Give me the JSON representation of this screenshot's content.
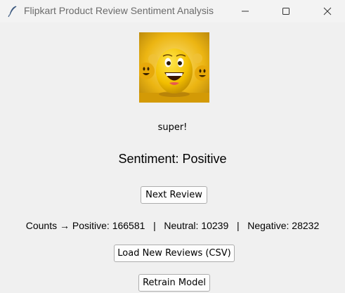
{
  "window": {
    "title": "Flipkart Product Review Sentiment Analysis",
    "icon": "feather-icon"
  },
  "review": {
    "text": "super!"
  },
  "sentiment": {
    "label": "Sentiment: Positive"
  },
  "buttons": {
    "next_review": "Next Review",
    "load_reviews": "Load New Reviews (CSV)",
    "retrain_model": "Retrain Model"
  },
  "counts": {
    "prefix": "Counts →",
    "positive_label": "Positive:",
    "positive_value": "166581",
    "separator": "|",
    "neutral_label": "Neutral:",
    "neutral_value": "10239",
    "negative_label": "Negative:",
    "negative_value": "28232"
  },
  "colors": {
    "window_bg": "#f0f0f0",
    "emoji_yellow": "#f5c400",
    "image_bg": "#e9b20f"
  }
}
